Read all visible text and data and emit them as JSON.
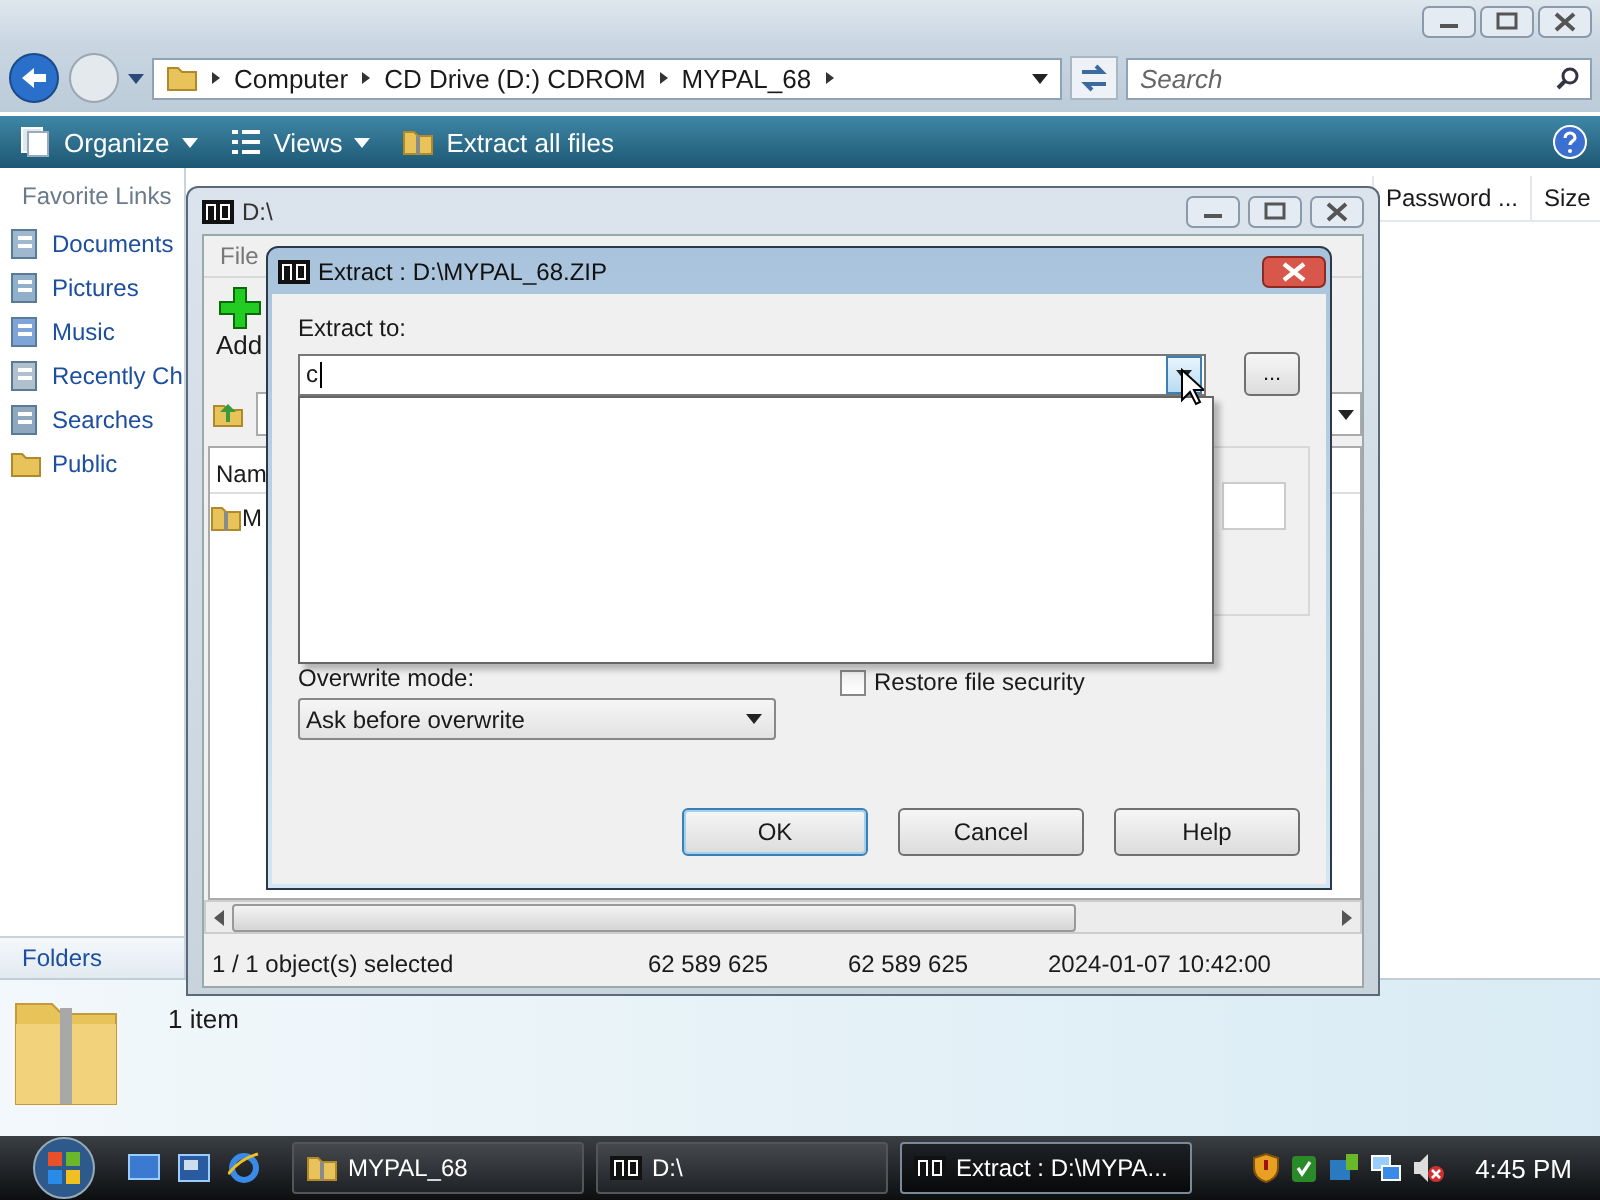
{
  "explorer": {
    "breadcrumb": [
      "Computer",
      "CD Drive (D:) CDROM",
      "MYPAL_68"
    ],
    "search": {
      "placeholder": "Search"
    },
    "toolbar": [
      "Organize",
      "Views",
      "Extract all files"
    ],
    "favorites_title": "Favorite Links",
    "favorites": [
      "Documents",
      "Pictures",
      "Music",
      "Recently Ch",
      "Searches",
      "Public"
    ],
    "columns": [
      "Password ...",
      "Size"
    ],
    "folders_label": "Folders",
    "details": "1 item"
  },
  "archive_window": {
    "title": "D:\\",
    "menu": [
      "File"
    ],
    "toolbar": [
      "Add"
    ],
    "columns": [
      "Nam"
    ],
    "rows": [
      "M"
    ],
    "status": [
      "1 / 1 object(s) selected",
      "62 589 625",
      "62 589 625",
      "2024-01-07 10:42:00"
    ]
  },
  "extract_dialog": {
    "title": "Extract : D:\\MYPAL_68.ZIP",
    "extract_to_label": "Extract to:",
    "extract_to_value": "c",
    "browse": "...",
    "dropdown_open": true,
    "overwrite_label": "Overwrite mode:",
    "overwrite_value": "Ask before overwrite",
    "restore_security": {
      "label": "Restore file security",
      "checked": false
    },
    "buttons": [
      {
        "label": "OK",
        "default": true
      },
      {
        "label": "Cancel",
        "default": false
      },
      {
        "label": "Help",
        "default": false
      }
    ]
  },
  "taskbar": {
    "tasks": [
      {
        "label": "MYPAL_68",
        "selected": false
      },
      {
        "label": "D:\\",
        "selected": false
      },
      {
        "label": "Extract : D:\\MYPA...",
        "selected": true
      }
    ],
    "clock": "4:45 PM"
  }
}
